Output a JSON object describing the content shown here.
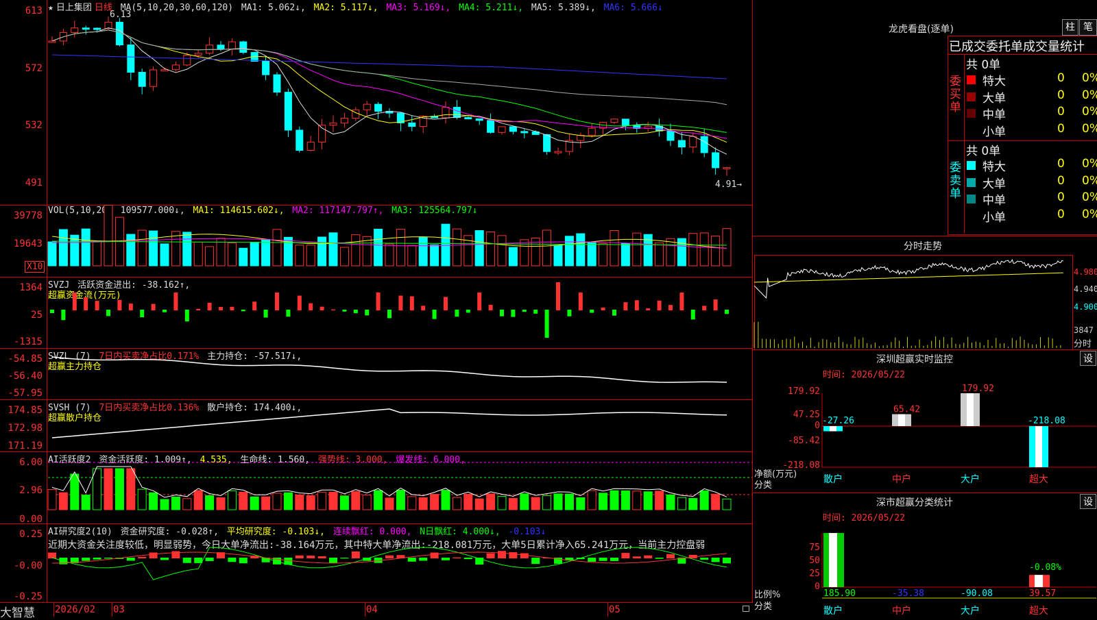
{
  "main": {
    "header": {
      "star": "★",
      "stock": "日上集团",
      "period": "日线",
      "ma_title": "MA(5,10,20,30,60,120)",
      "ma1": "MA1: 5.062↓,",
      "ma2": "MA2: 5.117↓,",
      "ma3": "MA3: 5.169↓,",
      "ma4": "MA4: 5.211↓,",
      "ma5": "MA5: 5.389↓,",
      "ma6": "MA6: 5.666↓"
    },
    "axis": [
      "613",
      "572",
      "532",
      "491"
    ],
    "high_label": "6.13",
    "last_label": "4.91→"
  },
  "vol": {
    "header": {
      "title": "VOL(5,10,20)",
      "val": "109577.000↓,",
      "ma1": "MA1: 114615.602↓,",
      "ma2": "MA2: 117147.797↑,",
      "ma3": "MA3: 125564.797↓"
    },
    "axis": [
      "39778",
      "19643"
    ],
    "unit": "X10"
  },
  "svzj": {
    "header": {
      "title": "SVZJ",
      "a": "活跃资金进出: -38.162↑,",
      "b": "超赢资金流(万元)"
    },
    "axis": [
      "1364",
      "25",
      "-1315"
    ]
  },
  "svzl": {
    "header": {
      "title": "SVZL (7)",
      "a": "7日内买卖净占比0.171%",
      "b": "主力持仓: -57.517↓,",
      "c": "超赢主力持仓"
    },
    "axis": [
      "-54.85",
      "-56.40",
      "-57.95"
    ]
  },
  "svsh": {
    "header": {
      "title": "SVSH (7)",
      "a": "7日内买卖净占比0.136%",
      "b": "散户持仓: 174.400↓,",
      "c": "超赢散户持仓"
    },
    "axis": [
      "174.85",
      "172.98",
      "171.19"
    ]
  },
  "ai1": {
    "header": {
      "title": "AI活跃度2",
      "a": "资金活跃度: 1.009↑,",
      "b": "4.535,",
      "c": "生命线: 1.560,",
      "d": "强势线: 3.000,",
      "e": "爆发线: 6.000,"
    },
    "axis": [
      "6.00",
      "2.96",
      "0.00"
    ]
  },
  "ai2": {
    "header": {
      "title": "AI研究度2(10)",
      "a": "资金研究度: -0.028↑,",
      "b": "平均研究度: -0.103↓,",
      "c": "连续飘红: 0.000,",
      "d": "N日飘红: 4.000↓,",
      "e": "-0.103↓"
    },
    "text": "近期大资金关注度较低，明显弱势，今日大单净流出:-38.164万元，其中特大单净流出:-218.081万元，大单5日累计净入65.241万元，当前主力控盘弱",
    "axis": [
      "0.25",
      "-0.00",
      "-0.25"
    ]
  },
  "footer": {
    "brand": "大智慧",
    "dates": [
      "2026/02",
      "03",
      "04",
      "05"
    ]
  },
  "right": {
    "lhkp": {
      "title": "龙虎看盘(逐单)",
      "btn1": "柱",
      "btn2": "笔",
      "subtitle": "已成交委托单成交量统计",
      "buy_label": "委买单",
      "sell_label": "委卖单",
      "buy_total": "共 0单",
      "sell_total": "共 0单",
      "buy_rows": [
        {
          "name": "特大",
          "v": "0",
          "p": "0%",
          "color": "#f00"
        },
        {
          "name": "大单",
          "v": "0",
          "p": "0%",
          "color": "#900"
        },
        {
          "name": "中单",
          "v": "0",
          "p": "0%",
          "color": "#600"
        },
        {
          "name": "小单",
          "v": "0",
          "p": "0%",
          "color": ""
        }
      ],
      "sell_rows": [
        {
          "name": "特大",
          "v": "0",
          "p": "0%",
          "color": "#0ff"
        },
        {
          "name": "大单",
          "v": "0",
          "p": "0%",
          "color": "#0aa"
        },
        {
          "name": "中单",
          "v": "0",
          "p": "0%",
          "color": "#088"
        },
        {
          "name": "小单",
          "v": "0",
          "p": "0%",
          "color": ""
        }
      ]
    },
    "fenshi": {
      "title": "分时走势",
      "axis": [
        "4.980",
        "4.940",
        "4.900"
      ],
      "vol_axis": [
        "3847",
        "分时"
      ]
    },
    "szcy": {
      "title": "深圳超赢实时监控",
      "btn": "设",
      "time": "时间: 2026/05/22",
      "ylabel": "净额(万元)",
      "xlabel": "分类",
      "axis": [
        "179.92",
        "47.25",
        "0",
        "-85.42",
        "-218.08"
      ],
      "cats": [
        "散户",
        "中户",
        "大户",
        "超大"
      ],
      "values": [
        -27.26,
        65.42,
        179.92,
        -218.08
      ],
      "labels": [
        "-27.26",
        "65.42",
        "179.92",
        "-218.08"
      ]
    },
    "scfl": {
      "title": "深市超赢分类统计",
      "btn": "设",
      "time": "时间: 2026/05/22",
      "ylabel": "比例%",
      "xlabel": "分类",
      "axis": [
        "75",
        "50",
        "25",
        "0"
      ],
      "cats": [
        "散户",
        "中户",
        "大户",
        "超大"
      ],
      "values": [
        185.9,
        -35.38,
        -90.08,
        39.57
      ],
      "labels": [
        "185.90",
        "-35.38",
        "-90.08",
        "39.57"
      ],
      "extra": "-0.08%"
    }
  },
  "colors": {
    "up": "#ff3232",
    "down": "#00ffff",
    "grid": "#c00000"
  }
}
